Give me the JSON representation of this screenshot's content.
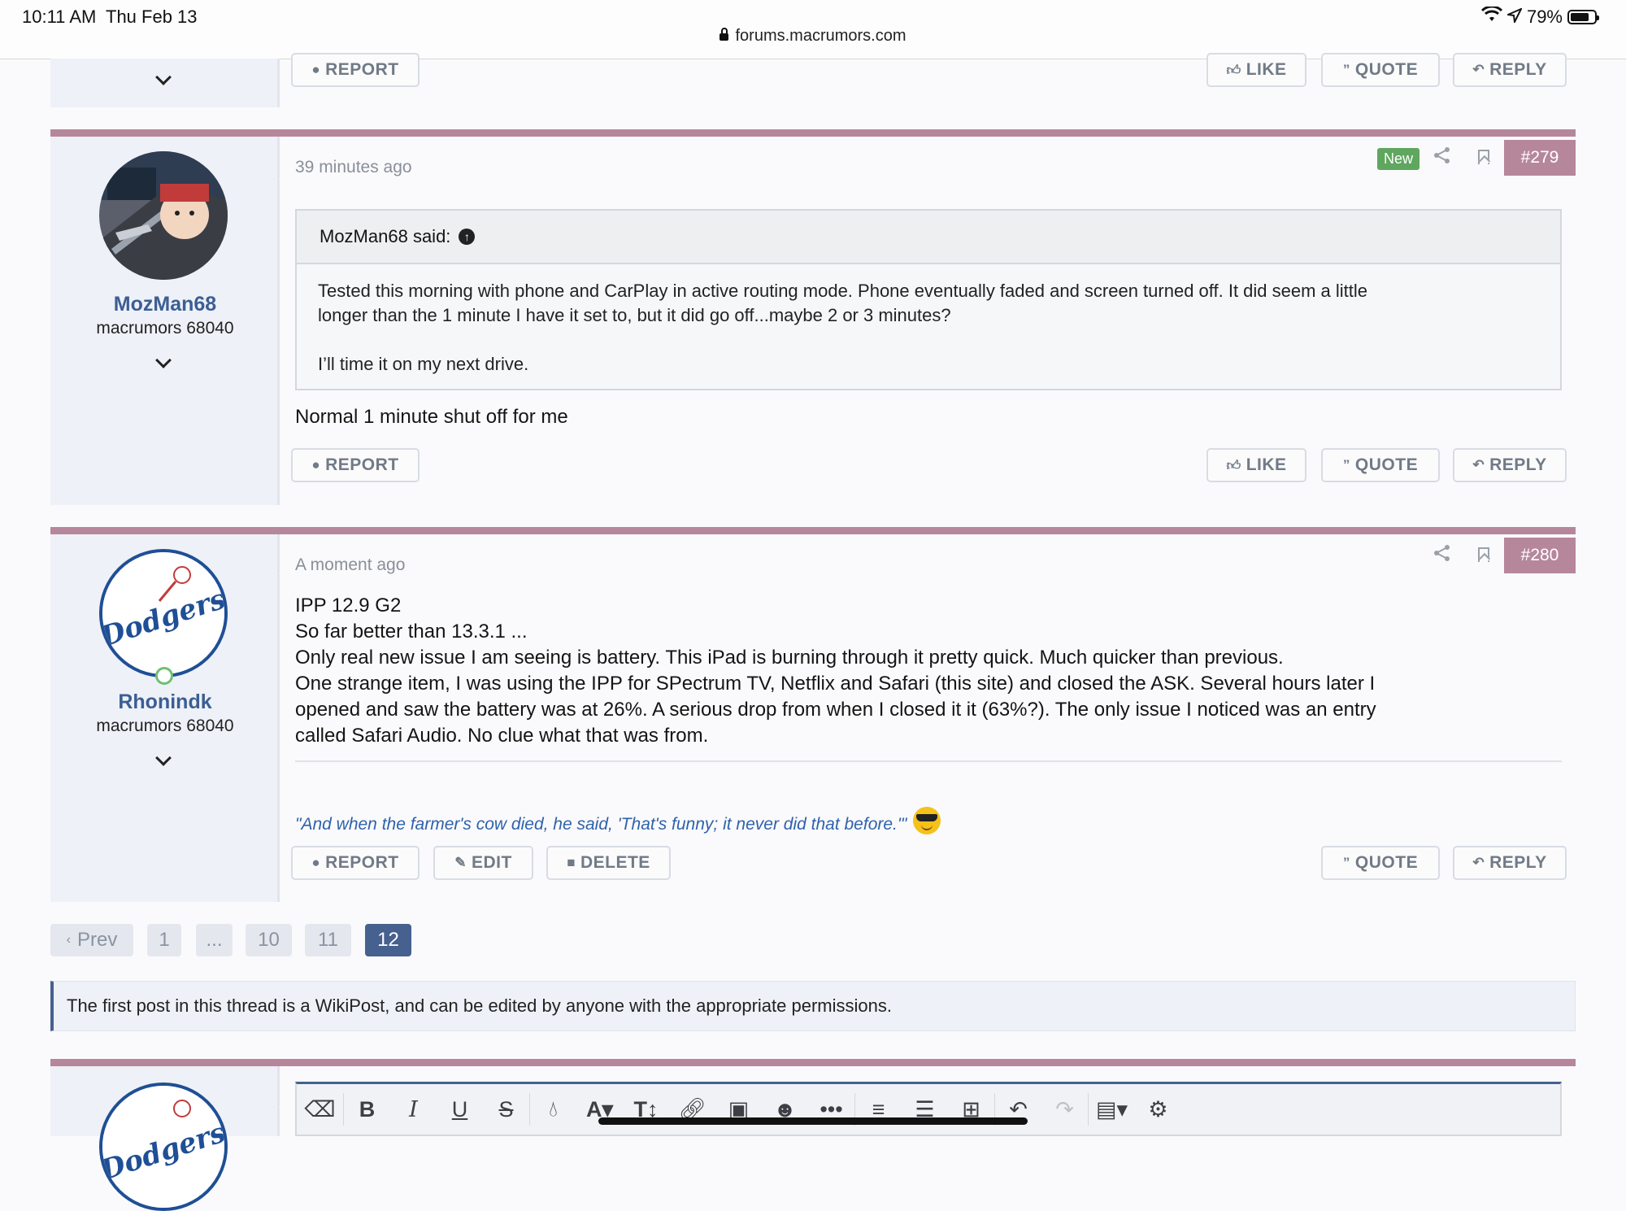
{
  "status_bar": {
    "time": "10:11 AM",
    "date": "Thu Feb 13",
    "battery": "79%",
    "url": "forums.macrumors.com"
  },
  "buttons": {
    "report": "REPORT",
    "like": "LIKE",
    "quote": "QUOTE",
    "reply": "REPLY",
    "edit": "EDIT",
    "delete": "DELETE"
  },
  "posts": [
    {
      "number": "#279",
      "badge": "New",
      "timestamp": "39 minutes ago",
      "author": {
        "name": "MozMan68",
        "title": "macrumors 68040"
      },
      "quote": {
        "author": "MozMan68 said:",
        "line1": "Tested this morning with phone and CarPlay in active routing mode. Phone eventually faded and screen turned off. It did seem a little",
        "line2": "longer than the 1 minute I have it set to, but it did go off...maybe 2 or 3 minutes?",
        "line3": "I’ll time it on my next drive."
      },
      "message": "Normal 1 minute shut off for me"
    },
    {
      "number": "#280",
      "timestamp": "A moment ago",
      "author": {
        "name": "Rhonindk",
        "title": "macrumors 68040"
      },
      "message_lines": [
        "IPP 12.9 G2",
        "So far better than 13.3.1 ...",
        "Only real new issue I am seeing is battery. This iPad is burning through it pretty quick. Much quicker than previous.",
        "One strange item, I was using the IPP for SPectrum TV, Netflix and Safari (this site) and closed the ASK. Several hours later I",
        "opened and saw the battery was at 26%. A serious drop from when I closed it it (63%?). The only issue I noticed was an entry",
        "called Safari Audio. No clue what that was from."
      ],
      "signature": "\"And when the farmer's cow died, he said, 'That's funny; it never did that before.'\""
    }
  ],
  "pagination": {
    "prev": "Prev",
    "pages": [
      "1",
      "...",
      "10",
      "11",
      "12"
    ],
    "current": "12"
  },
  "notice": "The first post in this thread is a WikiPost, and can be edited by anyone with the appropriate permissions.",
  "colors": {
    "accent": "#b6879b",
    "link": "#3c5e93",
    "primary": "#46608f",
    "new_badge": "#5fa65f"
  }
}
